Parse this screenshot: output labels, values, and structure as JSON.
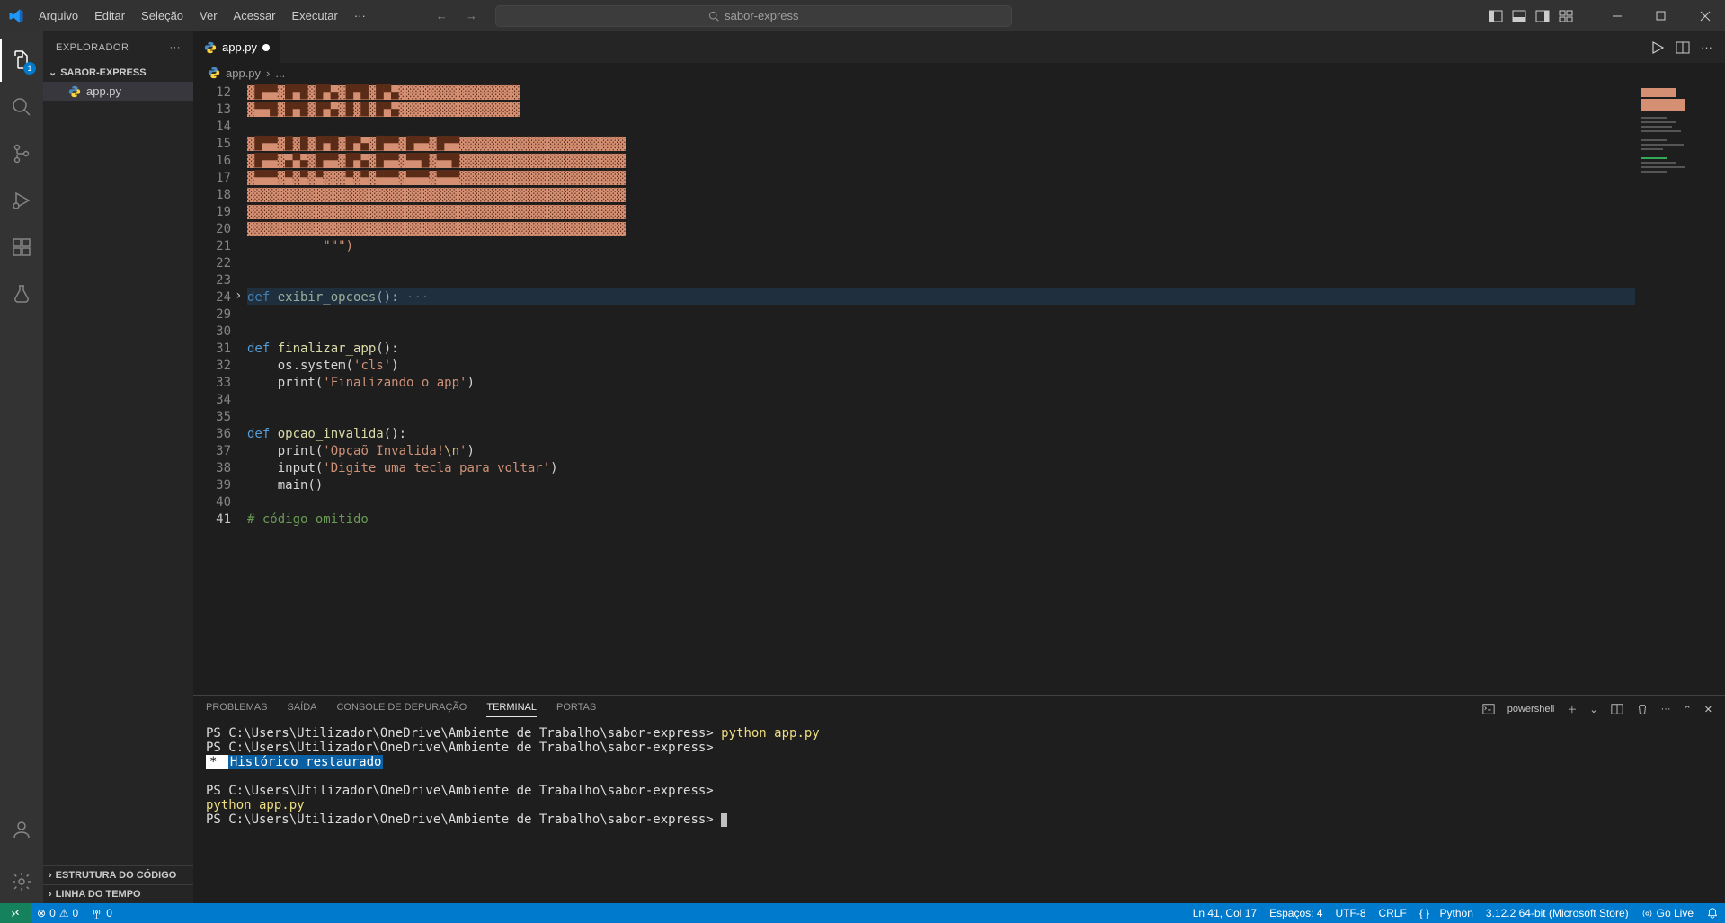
{
  "menu": [
    "Arquivo",
    "Editar",
    "Seleção",
    "Ver",
    "Acessar",
    "Executar",
    "···"
  ],
  "search_placeholder": "sabor-express",
  "explorer_title": "EXPLORADOR",
  "workspace_name": "SABOR-EXPRESS",
  "file_name": "app.py",
  "tab_name": "app.py",
  "breadcrumb_file": "app.py",
  "breadcrumb_symbol": "...",
  "outline_label": "ESTRUTURA DO CÓDIGO",
  "timeline_label": "LINHA DO TEMPO",
  "activity_badge": "1",
  "gutter": [
    "12",
    "13",
    "14",
    "15",
    "16",
    "17",
    "18",
    "19",
    "20",
    "21",
    "22",
    "23",
    "24",
    "29",
    "30",
    "31",
    "32",
    "33",
    "34",
    "35",
    "36",
    "37",
    "38",
    "39",
    "40",
    "41"
  ],
  "code": {
    "l21_q": "\"\"\")",
    "l24_def": "def ",
    "l24_fn": "exibir_opcoes",
    "l24_rest": "(): ",
    "l24_dots": "···",
    "l31_def": "def ",
    "l31_fn": "finalizar_app",
    "l31_rest": "():",
    "l32_a": "    os.system(",
    "l32_s": "'cls'",
    "l32_b": ")",
    "l33_a": "    print(",
    "l33_s": "'Finalizando o app'",
    "l33_b": ")",
    "l36_def": "def ",
    "l36_fn": "opcao_invalida",
    "l36_rest": "():",
    "l37_a": "    print(",
    "l37_s1": "'Opçaõ Invalida!",
    "l37_esc": "\\n",
    "l37_s2": "'",
    "l37_b": ")",
    "l38_a": "    input(",
    "l38_s": "'Digite uma tecla para voltar'",
    "l38_b": ")",
    "l39": "    main()",
    "l41": "# código omitido"
  },
  "panel_tabs": [
    "PROBLEMAS",
    "SAÍDA",
    "CONSOLE DE DEPURAÇÃO",
    "TERMINAL",
    "PORTAS"
  ],
  "terminal_shell": "powershell",
  "terminal": {
    "prompt": "PS C:\\Users\\Utilizador\\OneDrive\\Ambiente de Trabalho\\sabor-express> ",
    "cmd": "python app.py",
    "hist_star": " * ",
    "hist": " Histórico restaurado ",
    "indent_cmd": "                                                                         python app.py"
  },
  "status": {
    "errors": "0",
    "warnings": "0",
    "ports": "0",
    "cursor": "Ln 41, Col 17",
    "spaces": "Espaços: 4",
    "encoding": "UTF-8",
    "eol": "CRLF",
    "lang": "Python",
    "interpreter": "3.12.2 64-bit (Microsoft Store)",
    "golive": "Go Live"
  }
}
